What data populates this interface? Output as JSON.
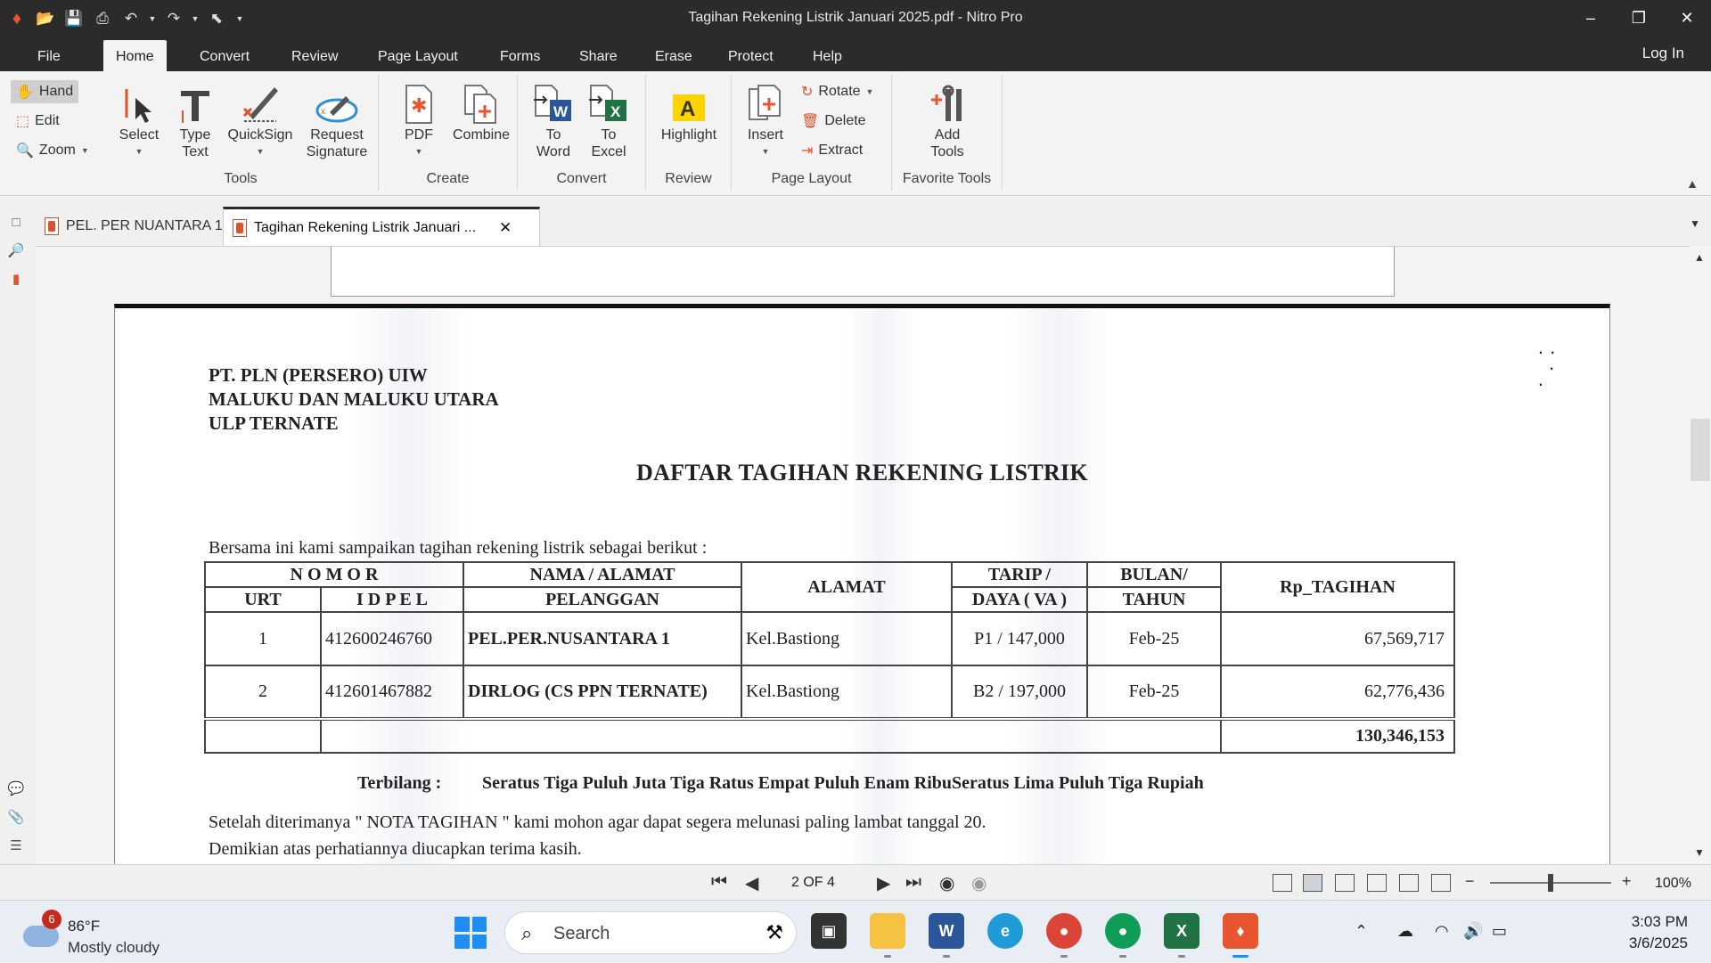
{
  "window": {
    "title": "Tagihan Rekening Listrik Januari 2025.pdf - Nitro Pro"
  },
  "ribbon_tabs": [
    "File",
    "Home",
    "Convert",
    "Review",
    "Page Layout",
    "Forms",
    "Share",
    "Erase",
    "Protect",
    "Help"
  ],
  "active_tab": "Home",
  "login_label": "Log In",
  "ribbon": {
    "tools": {
      "hand": "Hand",
      "edit": "Edit",
      "zoom": "Zoom",
      "select": "Select",
      "type_text_1": "Type",
      "type_text_2": "Text",
      "quicksign": "QuickSign",
      "request_sig_1": "Request",
      "request_sig_2": "Signature",
      "group": "Tools"
    },
    "create": {
      "pdf": "PDF",
      "combine": "Combine",
      "group": "Create"
    },
    "convert": {
      "to_word_1": "To",
      "to_word_2": "Word",
      "to_excel_1": "To",
      "to_excel_2": "Excel",
      "group": "Convert"
    },
    "review": {
      "highlight": "Highlight",
      "group": "Review"
    },
    "page_layout": {
      "insert": "Insert",
      "rotate": "Rotate",
      "delete": "Delete",
      "extract": "Extract",
      "group": "Page Layout"
    },
    "favorites": {
      "add_tools_1": "Add",
      "add_tools_2": "Tools",
      "group": "Favorite Tools"
    }
  },
  "doc_tabs": [
    {
      "label": "PEL. PER NUANTARA 1"
    },
    {
      "label": "Tagihan Rekening Listrik Januari ..."
    }
  ],
  "document": {
    "header": [
      "PT. PLN (PERSERO) UIW",
      "MALUKU DAN MALUKU UTARA",
      "ULP TERNATE"
    ],
    "title": "DAFTAR TAGIHAN REKENING LISTRIK",
    "intro": "Bersama ini kami sampaikan  tagihan rekening  listrik sebagai berikut :",
    "table": {
      "h_nomor": "N O M O R",
      "h_nama": "NAMA / ALAMAT",
      "h_alamat": "ALAMAT",
      "h_tarip": "TARIP /",
      "h_bulan": "BULAN/",
      "h_tagihan": "Rp_TAGIHAN",
      "h_urt": "URT",
      "h_idpel": "I D P E L",
      "h_pelanggan": "PELANGGAN",
      "h_daya": "DAYA ( VA )",
      "h_tahun": "TAHUN",
      "rows": [
        {
          "urt": "1",
          "idpel": "412600246760",
          "nama": "PEL.PER.NUSANTARA 1",
          "alamat": "Kel.Bastiong",
          "tarip": "P1 / 147,000",
          "bulan": "Feb-25",
          "tagihan": "67,569,717"
        },
        {
          "urt": "2",
          "idpel": "412601467882",
          "nama": "DIRLOG (CS PPN TERNATE)",
          "alamat": "Kel.Bastiong",
          "tarip": "B2 / 197,000",
          "bulan": "Feb-25",
          "tagihan": "62,776,436"
        }
      ],
      "total": "130,346,153"
    },
    "terbilang_label": "Terbilang :",
    "terbilang_text": "Seratus Tiga Puluh Juta Tiga Ratus Empat Puluh Enam RibuSeratus Lima Puluh Tiga Rupiah",
    "footer1": "Setelah diterimanya \" NOTA TAGIHAN \" kami mohon agar dapat segera melunasi paling lambat tanggal 20.",
    "footer2": "Demikian atas perhatiannya diucapkan terima kasih."
  },
  "nav": {
    "page_indicator": "2 OF 4",
    "zoom": "100%",
    "zoom_level_percent": 100
  },
  "taskbar": {
    "weather_temp": "86°F",
    "weather_cond": "Mostly cloudy",
    "weather_badge": "6",
    "search_placeholder": "Search",
    "time": "3:03 PM",
    "date": "3/6/2025"
  },
  "colors": {
    "titlebar": "#2b2b2b",
    "ribbon": "#f3f3f3",
    "nitro_accent": "#d9532c",
    "windows_blue": "#1e8ef5"
  }
}
